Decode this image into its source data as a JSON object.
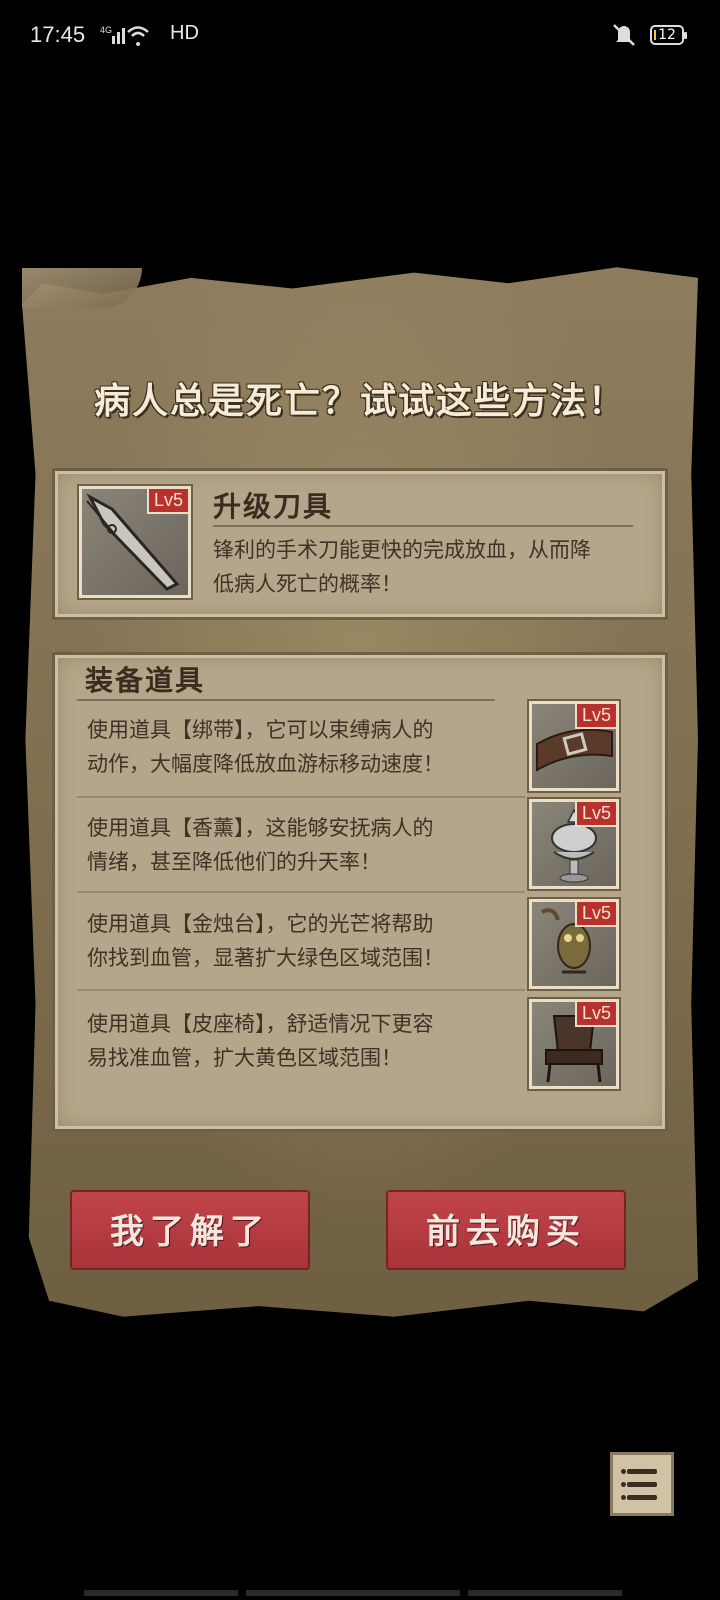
{
  "status": {
    "time": "17:45",
    "network": "HD",
    "battery": "12"
  },
  "dialog": {
    "title": "病人总是死亡？试试这些方法！",
    "upgrade": {
      "level": "Lv5",
      "heading": "升级刀具",
      "desc_line1": "锋利的手术刀能更快的完成放血，从而降",
      "desc_line2": "低病人死亡的概率！"
    },
    "equipment": {
      "heading": "装备道具",
      "items": [
        {
          "line1": "使用道具【绑带】，它可以束缚病人的",
          "line2": "动作，大幅度降低放血游标移动速度！",
          "level": "Lv5",
          "icon": "bandage-icon"
        },
        {
          "line1": "使用道具【香薰】，这能够安抚病人的",
          "line2": "情绪，甚至降低他们的升天率！",
          "level": "Lv5",
          "icon": "incense-icon"
        },
        {
          "line1": "使用道具【金烛台】，它的光芒将帮助",
          "line2": "你找到血管，显著扩大绿色区域范围！",
          "level": "Lv5",
          "icon": "candlestick-icon"
        },
        {
          "line1": "使用道具【皮座椅】，舒适情况下更容",
          "line2": "易找准血管，扩大黄色区域范围！",
          "level": "Lv5",
          "icon": "chair-icon"
        }
      ]
    },
    "buttons": {
      "ok": "我了解了",
      "buy": "前去购买"
    }
  },
  "colors": {
    "button_red": "#b83a40",
    "parchment": "#85755a",
    "level_badge": "#b8322d"
  }
}
